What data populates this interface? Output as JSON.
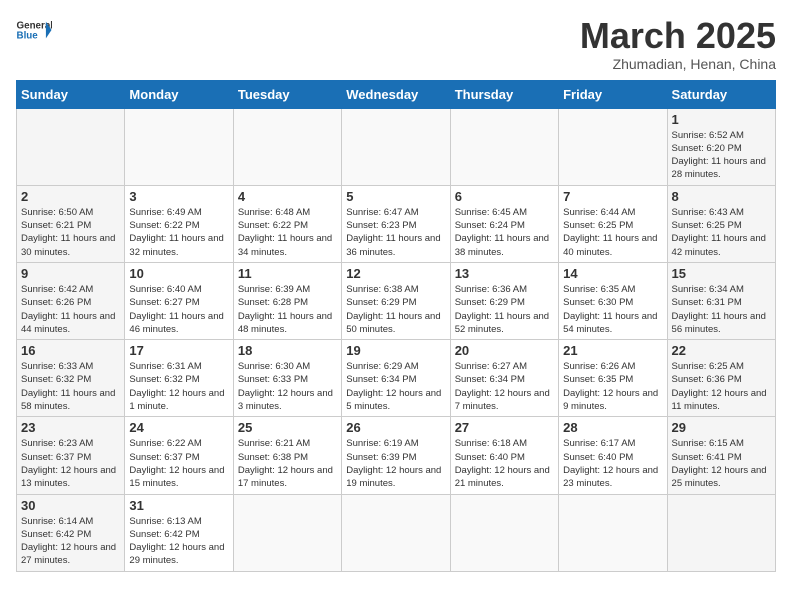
{
  "header": {
    "logo_general": "General",
    "logo_blue": "Blue",
    "month_title": "March 2025",
    "subtitle": "Zhumadian, Henan, China"
  },
  "days_of_week": [
    "Sunday",
    "Monday",
    "Tuesday",
    "Wednesday",
    "Thursday",
    "Friday",
    "Saturday"
  ],
  "weeks": [
    [
      {
        "day": "",
        "info": ""
      },
      {
        "day": "",
        "info": ""
      },
      {
        "day": "",
        "info": ""
      },
      {
        "day": "",
        "info": ""
      },
      {
        "day": "",
        "info": ""
      },
      {
        "day": "",
        "info": ""
      },
      {
        "day": "1",
        "info": "Sunrise: 6:52 AM\nSunset: 6:20 PM\nDaylight: 11 hours\nand 28 minutes."
      }
    ],
    [
      {
        "day": "2",
        "info": "Sunrise: 6:50 AM\nSunset: 6:21 PM\nDaylight: 11 hours\nand 30 minutes."
      },
      {
        "day": "3",
        "info": "Sunrise: 6:49 AM\nSunset: 6:22 PM\nDaylight: 11 hours\nand 32 minutes."
      },
      {
        "day": "4",
        "info": "Sunrise: 6:48 AM\nSunset: 6:22 PM\nDaylight: 11 hours\nand 34 minutes."
      },
      {
        "day": "5",
        "info": "Sunrise: 6:47 AM\nSunset: 6:23 PM\nDaylight: 11 hours\nand 36 minutes."
      },
      {
        "day": "6",
        "info": "Sunrise: 6:45 AM\nSunset: 6:24 PM\nDaylight: 11 hours\nand 38 minutes."
      },
      {
        "day": "7",
        "info": "Sunrise: 6:44 AM\nSunset: 6:25 PM\nDaylight: 11 hours\nand 40 minutes."
      },
      {
        "day": "8",
        "info": "Sunrise: 6:43 AM\nSunset: 6:25 PM\nDaylight: 11 hours\nand 42 minutes."
      }
    ],
    [
      {
        "day": "9",
        "info": "Sunrise: 6:42 AM\nSunset: 6:26 PM\nDaylight: 11 hours\nand 44 minutes."
      },
      {
        "day": "10",
        "info": "Sunrise: 6:40 AM\nSunset: 6:27 PM\nDaylight: 11 hours\nand 46 minutes."
      },
      {
        "day": "11",
        "info": "Sunrise: 6:39 AM\nSunset: 6:28 PM\nDaylight: 11 hours\nand 48 minutes."
      },
      {
        "day": "12",
        "info": "Sunrise: 6:38 AM\nSunset: 6:29 PM\nDaylight: 11 hours\nand 50 minutes."
      },
      {
        "day": "13",
        "info": "Sunrise: 6:36 AM\nSunset: 6:29 PM\nDaylight: 11 hours\nand 52 minutes."
      },
      {
        "day": "14",
        "info": "Sunrise: 6:35 AM\nSunset: 6:30 PM\nDaylight: 11 hours\nand 54 minutes."
      },
      {
        "day": "15",
        "info": "Sunrise: 6:34 AM\nSunset: 6:31 PM\nDaylight: 11 hours\nand 56 minutes."
      }
    ],
    [
      {
        "day": "16",
        "info": "Sunrise: 6:33 AM\nSunset: 6:32 PM\nDaylight: 11 hours\nand 58 minutes."
      },
      {
        "day": "17",
        "info": "Sunrise: 6:31 AM\nSunset: 6:32 PM\nDaylight: 12 hours\nand 1 minute."
      },
      {
        "day": "18",
        "info": "Sunrise: 6:30 AM\nSunset: 6:33 PM\nDaylight: 12 hours\nand 3 minutes."
      },
      {
        "day": "19",
        "info": "Sunrise: 6:29 AM\nSunset: 6:34 PM\nDaylight: 12 hours\nand 5 minutes."
      },
      {
        "day": "20",
        "info": "Sunrise: 6:27 AM\nSunset: 6:34 PM\nDaylight: 12 hours\nand 7 minutes."
      },
      {
        "day": "21",
        "info": "Sunrise: 6:26 AM\nSunset: 6:35 PM\nDaylight: 12 hours\nand 9 minutes."
      },
      {
        "day": "22",
        "info": "Sunrise: 6:25 AM\nSunset: 6:36 PM\nDaylight: 12 hours\nand 11 minutes."
      }
    ],
    [
      {
        "day": "23",
        "info": "Sunrise: 6:23 AM\nSunset: 6:37 PM\nDaylight: 12 hours\nand 13 minutes."
      },
      {
        "day": "24",
        "info": "Sunrise: 6:22 AM\nSunset: 6:37 PM\nDaylight: 12 hours\nand 15 minutes."
      },
      {
        "day": "25",
        "info": "Sunrise: 6:21 AM\nSunset: 6:38 PM\nDaylight: 12 hours\nand 17 minutes."
      },
      {
        "day": "26",
        "info": "Sunrise: 6:19 AM\nSunset: 6:39 PM\nDaylight: 12 hours\nand 19 minutes."
      },
      {
        "day": "27",
        "info": "Sunrise: 6:18 AM\nSunset: 6:40 PM\nDaylight: 12 hours\nand 21 minutes."
      },
      {
        "day": "28",
        "info": "Sunrise: 6:17 AM\nSunset: 6:40 PM\nDaylight: 12 hours\nand 23 minutes."
      },
      {
        "day": "29",
        "info": "Sunrise: 6:15 AM\nSunset: 6:41 PM\nDaylight: 12 hours\nand 25 minutes."
      }
    ],
    [
      {
        "day": "30",
        "info": "Sunrise: 6:14 AM\nSunset: 6:42 PM\nDaylight: 12 hours\nand 27 minutes."
      },
      {
        "day": "31",
        "info": "Sunrise: 6:13 AM\nSunset: 6:42 PM\nDaylight: 12 hours\nand 29 minutes."
      },
      {
        "day": "",
        "info": ""
      },
      {
        "day": "",
        "info": ""
      },
      {
        "day": "",
        "info": ""
      },
      {
        "day": "",
        "info": ""
      },
      {
        "day": "",
        "info": ""
      }
    ]
  ]
}
